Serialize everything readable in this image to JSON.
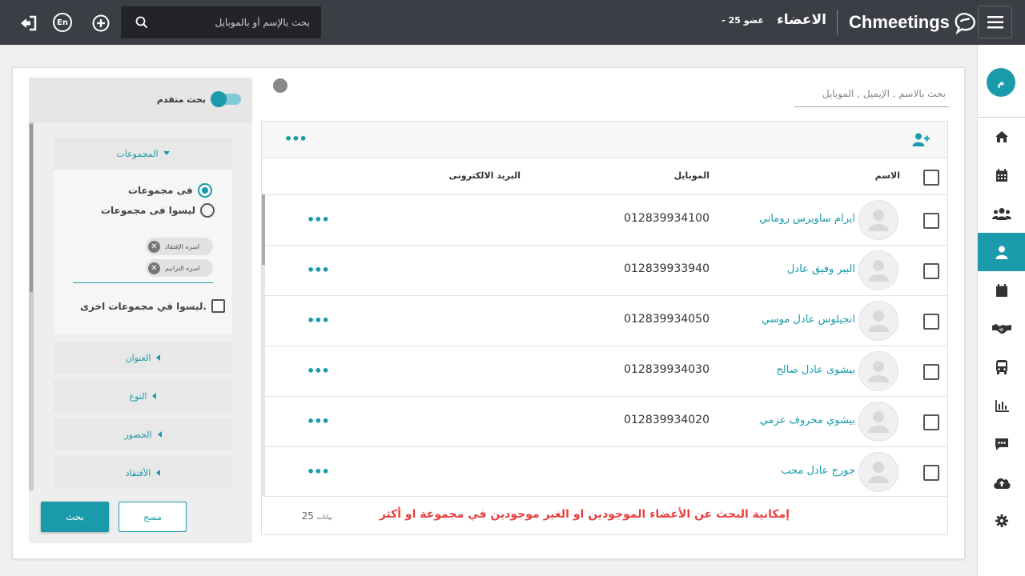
{
  "topbar": {
    "logo_text": "Chmeetings",
    "page_title": "الاعضاء",
    "member_count": "- 25 عضو",
    "search_placeholder": "بحث بالإسم أو بالموبايل",
    "lang_label": "En"
  },
  "sidebar": {
    "avatar_letter": "م",
    "items": [
      {
        "icon": "home-icon",
        "active": false
      },
      {
        "icon": "calendar-icon",
        "active": false
      },
      {
        "icon": "groups-icon",
        "active": false
      },
      {
        "icon": "person-icon",
        "active": true
      },
      {
        "icon": "event-calendar-icon",
        "active": false
      },
      {
        "icon": "handshake-icon",
        "active": false
      },
      {
        "icon": "bus-icon",
        "active": false
      },
      {
        "icon": "reports-icon",
        "active": false
      },
      {
        "icon": "messages-icon",
        "active": false
      },
      {
        "icon": "cloud-upload-icon",
        "active": false
      },
      {
        "icon": "gear-icon",
        "active": false
      }
    ]
  },
  "filter": {
    "advanced_search_label": "بحث متقدم",
    "groups_header": "المجموعات",
    "radio_in_groups": "فى مجموعات",
    "radio_not_in_groups": "ليسوا فى مجموعات",
    "selected_radio": "in_groups",
    "chips": [
      "اسره الإفتقاد",
      "اسره الترانيم"
    ],
    "not_in_other_groups": "ليسوا في مجموعات اخرى.",
    "sections": [
      "العنوان",
      "النوع",
      "الحضور",
      "الأفتقاد"
    ],
    "search_button": "بحث",
    "clear_button": "مسح"
  },
  "table": {
    "search_placeholder": "بحث بالاسم , الإيميل , الموبايل",
    "columns": {
      "name": "الاسم",
      "mobile": "الموبايل",
      "email": "البريد الالكترونى"
    },
    "rows": [
      {
        "name": "ايرام ساويرس روماني",
        "mobile": "012839934100"
      },
      {
        "name": "البير وفيق عادل",
        "mobile": "012839933940"
      },
      {
        "name": "انجيلوس عادل موسي",
        "mobile": "012839934050"
      },
      {
        "name": "بيشوى عادل صالح",
        "mobile": "012839934030"
      },
      {
        "name": "بيشوي محروف عزمي",
        "mobile": "012839934020"
      },
      {
        "name": "جورج عادل محب",
        "mobile": ""
      }
    ],
    "footer_note": "إمكانية البحث عن الأعضاء الموجودين او الغير موجودين في مجموعة او أكثر",
    "record_count": "25",
    "record_label": "بيانات"
  },
  "colors": {
    "accent": "#1a9aab",
    "topbar": "#3b3e45",
    "note": "#e8403f"
  }
}
